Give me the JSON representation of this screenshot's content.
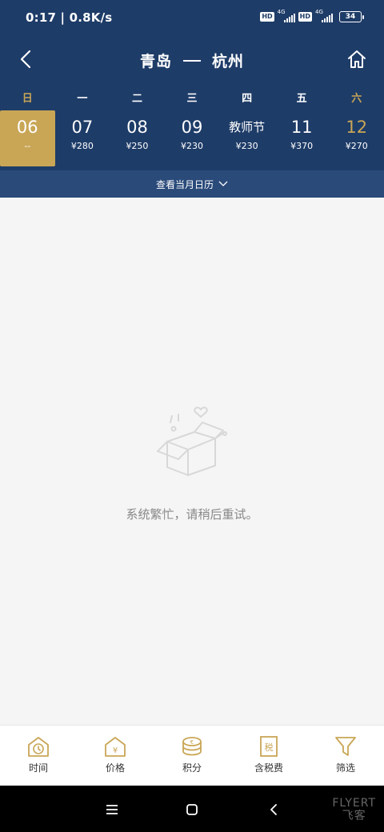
{
  "status": {
    "time_speed": "0:17 | 0.8K/s",
    "hd": "HD",
    "net1": "4G",
    "net2": "4G",
    "battery": "34"
  },
  "nav": {
    "from": "青岛",
    "to": "杭州"
  },
  "weekdays": [
    "日",
    "一",
    "二",
    "三",
    "四",
    "五",
    "六"
  ],
  "dates": [
    {
      "day": "06",
      "price": "--",
      "selected": true
    },
    {
      "day": "07",
      "price": "¥280"
    },
    {
      "day": "08",
      "price": "¥250"
    },
    {
      "day": "09",
      "price": "¥230"
    },
    {
      "day": "教师节",
      "price": "¥230"
    },
    {
      "day": "11",
      "price": "¥370"
    },
    {
      "day": "12",
      "price": "¥270"
    }
  ],
  "month_bar": {
    "label": "查看当月日历"
  },
  "empty": {
    "message": "系统繁忙，请稍后重试。"
  },
  "tabs": [
    {
      "label": "时间",
      "icon": "clock-icon"
    },
    {
      "label": "价格",
      "icon": "price-icon"
    },
    {
      "label": "积分",
      "icon": "points-icon"
    },
    {
      "label": "含税费",
      "icon": "tax-icon"
    },
    {
      "label": "筛选",
      "icon": "filter-icon"
    }
  ],
  "watermark": {
    "line1": "FLYERT",
    "line2": "飞客"
  },
  "colors": {
    "navy": "#1e3c68",
    "gold": "#c9a656"
  }
}
